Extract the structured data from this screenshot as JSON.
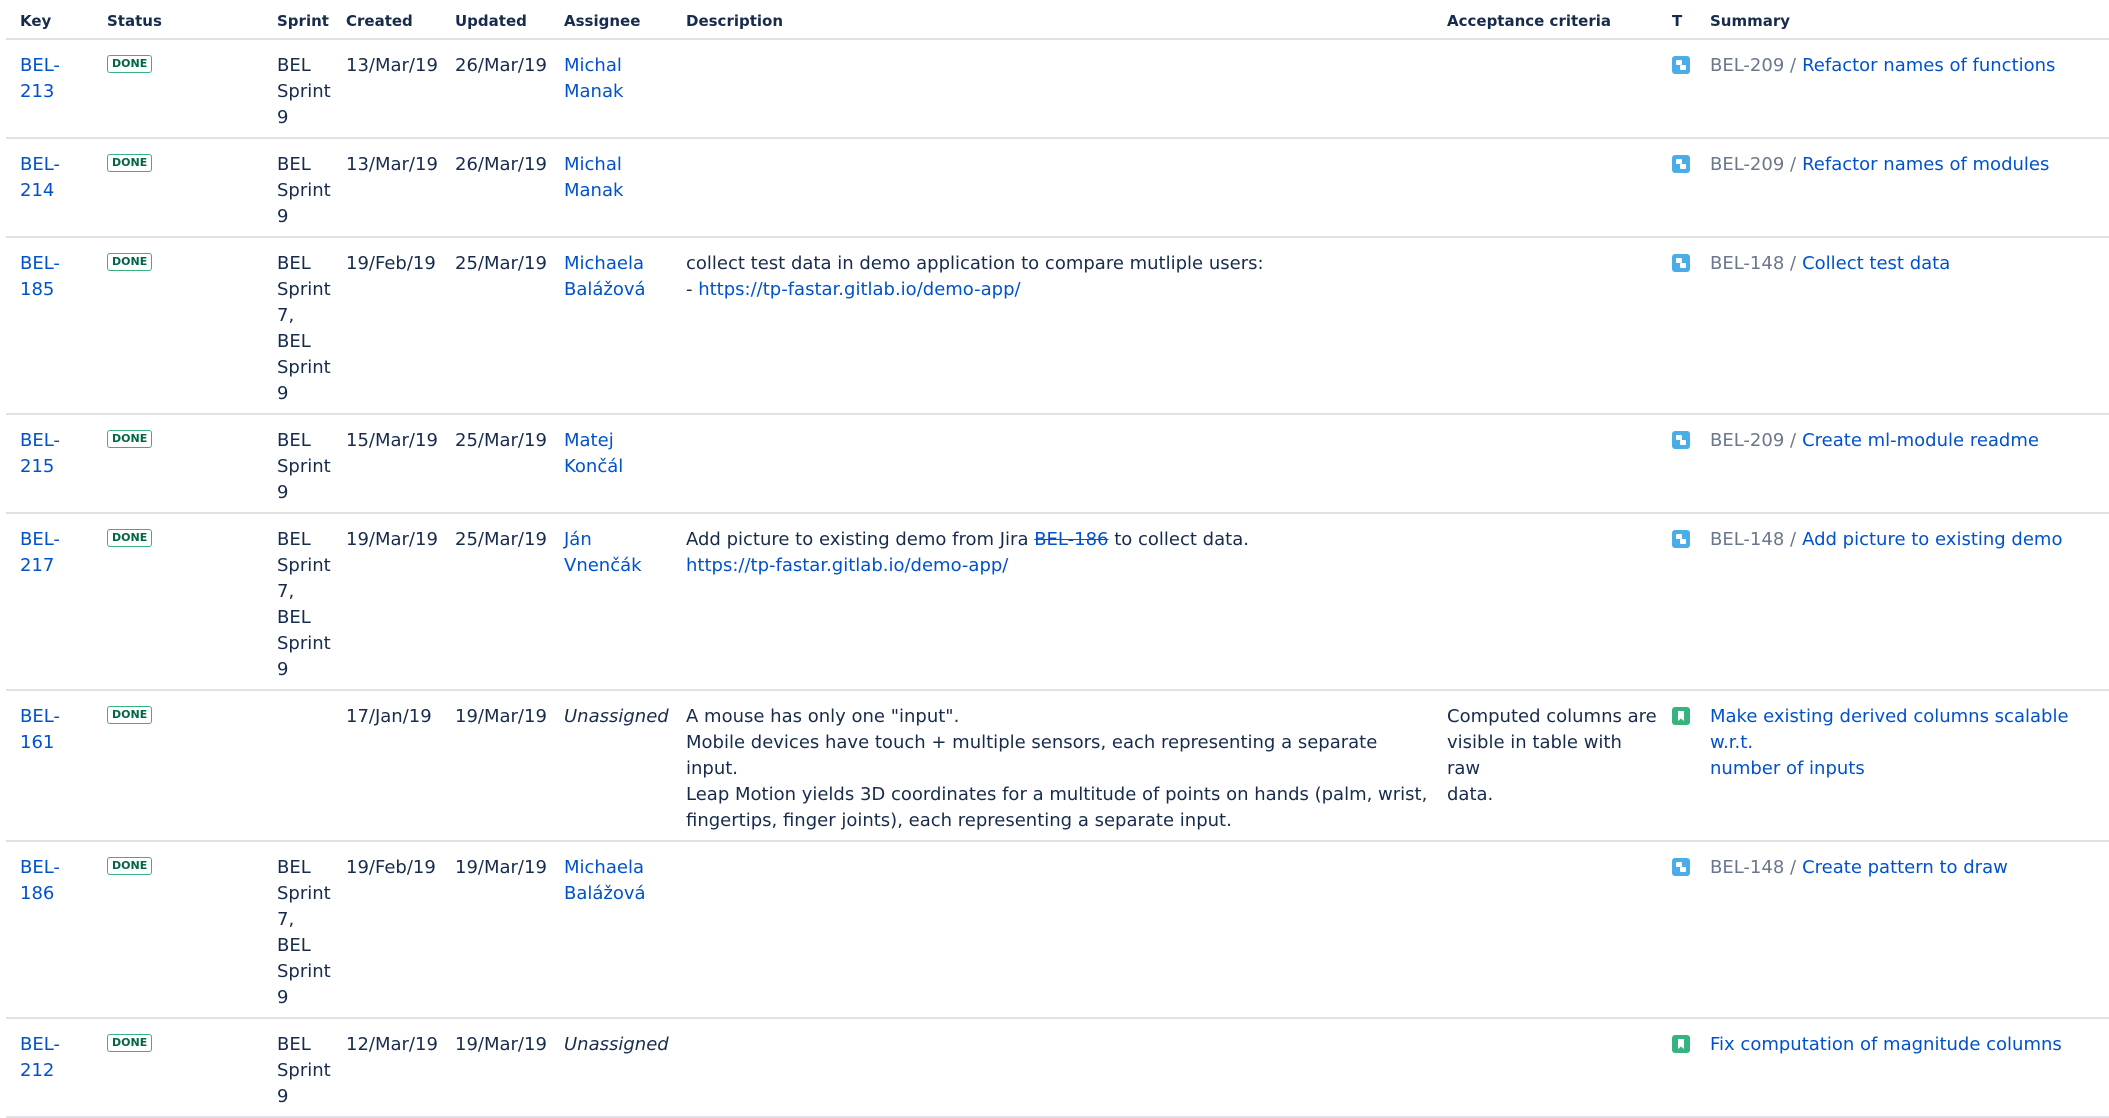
{
  "headers": {
    "key": "Key",
    "status": "Status",
    "sprint": "Sprint",
    "created": "Created",
    "updated": "Updated",
    "assignee": "Assignee",
    "description": "Description",
    "acceptance": "Acceptance criteria",
    "type": "T",
    "summary": "Summary"
  },
  "colors": {
    "link": "#0052cc",
    "done_border": "#36b37e",
    "done_text": "#006644",
    "subtask_icon": "#4bade8",
    "story_icon": "#36b37e"
  },
  "rows": [
    {
      "key": "BEL-213",
      "status": "DONE",
      "sprint_lines": [
        "BEL",
        "Sprint",
        "9"
      ],
      "created": "13/Mar/19",
      "updated": "26/Mar/19",
      "assignee_lines": [
        "Michal",
        "Manak"
      ],
      "type_icon": "subtask-icon",
      "parent": "BEL-209 /",
      "summary": "Refactor names of functions"
    },
    {
      "key": "BEL-214",
      "status": "DONE",
      "sprint_lines": [
        "BEL",
        "Sprint",
        "9"
      ],
      "created": "13/Mar/19",
      "updated": "26/Mar/19",
      "assignee_lines": [
        "Michal",
        "Manak"
      ],
      "type_icon": "subtask-icon",
      "parent": "BEL-209 /",
      "summary": "Refactor names of modules"
    },
    {
      "key": "BEL-185",
      "status": "DONE",
      "sprint_lines": [
        "BEL",
        "Sprint",
        "7, BEL",
        "Sprint",
        "9"
      ],
      "created": "19/Feb/19",
      "updated": "25/Mar/19",
      "assignee_lines": [
        "Michaela",
        "Balážová"
      ],
      "description_text": "collect test data in demo application to compare mutliple users:",
      "description_dash": "- ",
      "description_link": "https://tp-fastar.gitlab.io/demo-app/",
      "type_icon": "subtask-icon",
      "parent": "BEL-148 /",
      "summary": "Collect test data"
    },
    {
      "key": "BEL-215",
      "status": "DONE",
      "sprint_lines": [
        "BEL",
        "Sprint",
        "9"
      ],
      "created": "15/Mar/19",
      "updated": "25/Mar/19",
      "assignee_lines": [
        "Matej",
        "Končál"
      ],
      "type_icon": "subtask-icon",
      "parent": "BEL-209 /",
      "summary": "Create ml-module readme"
    },
    {
      "key": "BEL-217",
      "status": "DONE",
      "sprint_lines": [
        "BEL",
        "Sprint",
        "7, BEL",
        "Sprint",
        "9"
      ],
      "created": "19/Mar/19",
      "updated": "25/Mar/19",
      "assignee": "Ján Vnenčák",
      "description_pre": "Add picture to existing demo from Jira ",
      "description_struck": "BEL-186",
      "description_post": " to collect data.",
      "description_link": "https://tp-fastar.gitlab.io/demo-app/",
      "type_icon": "subtask-icon",
      "parent": "BEL-148 /",
      "summary": "Add picture to existing demo"
    },
    {
      "key": "BEL-161",
      "status": "DONE",
      "created": "17/Jan/19",
      "updated": "19/Mar/19",
      "assignee": "Unassigned",
      "description_lines": [
        "A mouse has only one \"input\".",
        "Mobile devices have touch + multiple sensors, each representing a separate input.",
        "Leap Motion yields 3D coordinates for a multitude of points on hands (palm, wrist,",
        "fingertips, finger joints), each representing a separate input."
      ],
      "acceptance_lines": [
        "Computed columns are",
        "visible in table with raw",
        "data."
      ],
      "type_icon": "story-icon",
      "summary_lines": [
        "Make existing derived columns scalable w.r.t.",
        "number of inputs"
      ]
    },
    {
      "key": "BEL-186",
      "status": "DONE",
      "sprint_lines": [
        "BEL",
        "Sprint",
        "7, BEL",
        "Sprint",
        "9"
      ],
      "created": "19/Feb/19",
      "updated": "19/Mar/19",
      "assignee_lines": [
        "Michaela",
        "Balážová"
      ],
      "type_icon": "subtask-icon",
      "parent": "BEL-148 /",
      "summary": "Create pattern to draw"
    },
    {
      "key": "BEL-212",
      "status": "DONE",
      "sprint_lines": [
        "BEL",
        "Sprint",
        "9"
      ],
      "created": "12/Mar/19",
      "updated": "19/Mar/19",
      "assignee": "Unassigned",
      "type_icon": "story-icon",
      "summary": "Fix computation of magnitude columns"
    }
  ]
}
